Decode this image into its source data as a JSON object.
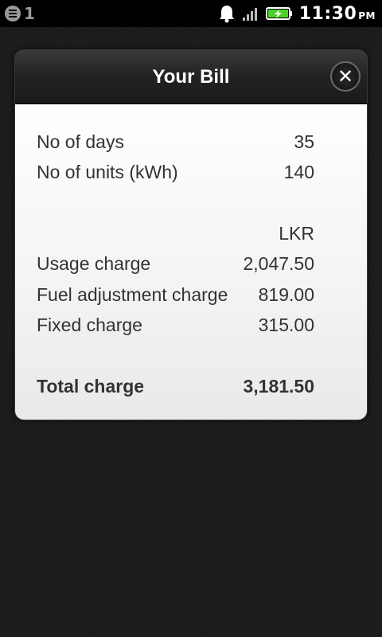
{
  "status_bar": {
    "notification_count": "1",
    "time": "11:30",
    "ampm": "PM"
  },
  "dialog": {
    "title": "Your Bill",
    "summary": [
      {
        "label": "No of days",
        "value": "35"
      },
      {
        "label": "No of units (kWh)",
        "value": "140"
      }
    ],
    "currency": "LKR",
    "charges": [
      {
        "label": "Usage charge",
        "value": "2,047.50"
      },
      {
        "label": "Fuel adjustment charge",
        "value": "819.00"
      },
      {
        "label": "Fixed charge",
        "value": "315.00"
      }
    ],
    "total": {
      "label": "Total charge",
      "value": "3,181.50"
    }
  }
}
